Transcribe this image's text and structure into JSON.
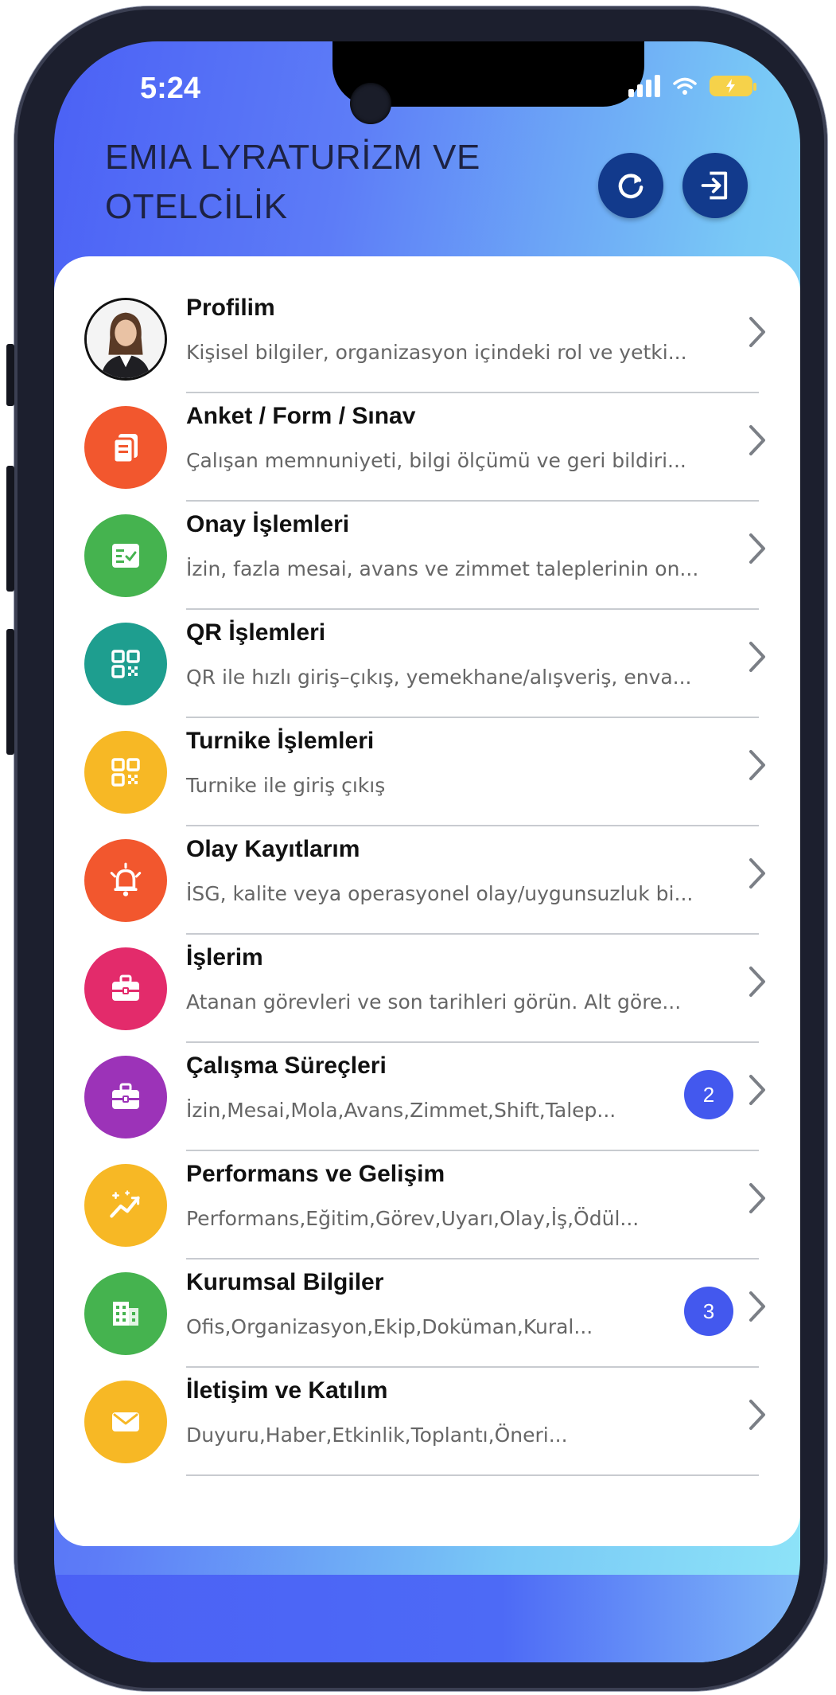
{
  "status_bar": {
    "time": "5:24"
  },
  "header": {
    "title_line1": "EMIA LYRATURİZM VE",
    "title_line2": "OTELCİLİK",
    "refresh_icon": "refresh-icon",
    "logout_icon": "logout-icon"
  },
  "colors": {
    "header_button": "#123a8c",
    "badge": "#4358ee"
  },
  "menu": [
    {
      "title": "Profilim",
      "subtitle": "Kişisel bilgiler, organizasyon içindeki rol ve yetki...",
      "icon": "profile-photo",
      "color": "#ffffff"
    },
    {
      "title": "Anket / Form / Sınav",
      "subtitle": "Çalışan memnuniyeti, bilgi ölçümü ve geri bildiri...",
      "icon": "form-icon",
      "color": "#f2572e"
    },
    {
      "title": "Onay İşlemleri",
      "subtitle": "İzin, fazla mesai, avans ve zimmet taleplerinin on...",
      "icon": "approval-icon",
      "color": "#45b34f"
    },
    {
      "title": "QR İşlemleri",
      "subtitle": "QR ile hızlı giriş–çıkış, yemekhane/alışveriş, enva...",
      "icon": "qr-icon",
      "color": "#1e9e8f"
    },
    {
      "title": "Turnike İşlemleri",
      "subtitle": "Turnike ile giriş çıkış",
      "icon": "qr-icon",
      "color": "#f7b825"
    },
    {
      "title": "Olay Kayıtlarım",
      "subtitle": "İSG, kalite veya operasyonel olay/uygunsuzluk bi...",
      "icon": "alarm-bell-icon",
      "color": "#f2572e"
    },
    {
      "title": "İşlerim",
      "subtitle": "Atanan görevleri ve son tarihleri görün. Alt göre...",
      "icon": "briefcase-icon",
      "color": "#e32b6b"
    },
    {
      "title": "Çalışma Süreçleri",
      "subtitle": "İzin,Mesai,Mola,Avans,Zimmet,Shift,Talep...",
      "icon": "briefcase-icon",
      "color": "#9c33b8",
      "badge": "2"
    },
    {
      "title": "Performans ve Gelişim",
      "subtitle": "Performans,Eğitim,Görev,Uyarı,Olay,İş,Ödül...",
      "icon": "growth-chart-icon",
      "color": "#f7b825"
    },
    {
      "title": "Kurumsal Bilgiler",
      "subtitle": "Ofis,Organizasyon,Ekip,Doküman,Kural...",
      "icon": "building-icon",
      "color": "#45b34f",
      "badge": "3"
    },
    {
      "title": "İletişim ve Katılım",
      "subtitle": "Duyuru,Haber,Etkinlik,Toplantı,Öneri...",
      "icon": "mail-icon",
      "color": "#f7b825"
    }
  ]
}
